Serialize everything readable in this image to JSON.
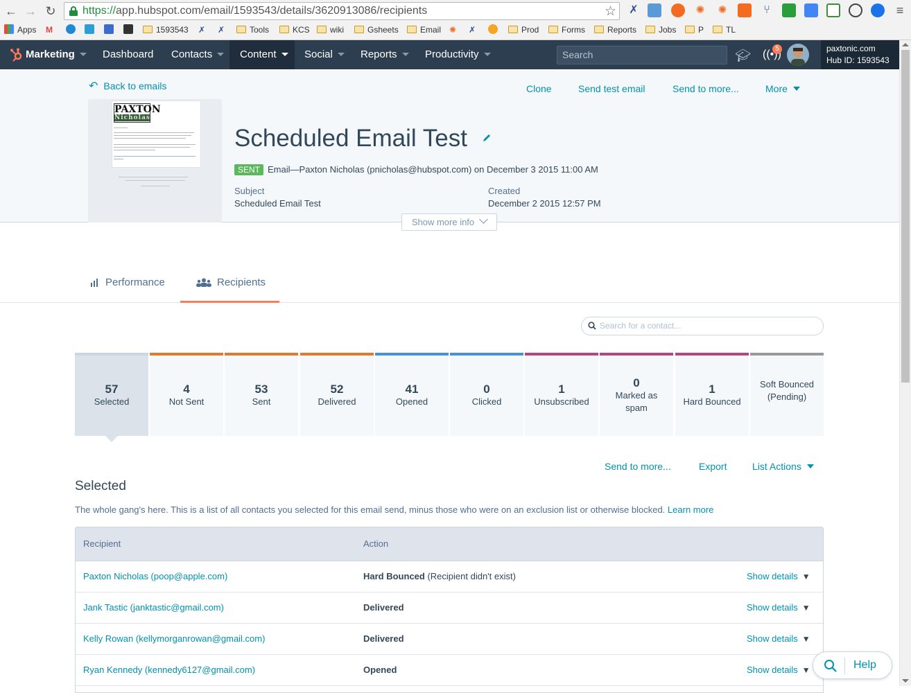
{
  "browser": {
    "url_scheme": "https://",
    "url_rest": "app.hubspot.com/email/1593543/details/3620913086/recipients",
    "bookmarks": [
      "Apps",
      "1593543",
      "Tools",
      "KCS",
      "wiki",
      "Gsheets",
      "Email",
      "Prod",
      "Forms",
      "Reports",
      "Jobs",
      "P",
      "TL"
    ]
  },
  "topnav": {
    "brand": "Marketing",
    "items": [
      "Dashboard",
      "Contacts",
      "Content",
      "Social",
      "Reports",
      "Productivity"
    ],
    "search_placeholder": "Search",
    "notification_count": "5",
    "portal_name": "paxtonic.com",
    "hub_id": "Hub ID: 1593543"
  },
  "header": {
    "back_label": "Back to emails",
    "actions": [
      "Clone",
      "Send test email",
      "Send to more...",
      "More"
    ],
    "title": "Scheduled Email Test",
    "sent_badge": "SENT",
    "sent_info": "Email—Paxton Nicholas (pnicholas@hubspot.com) on December 3 2015 11:00 AM",
    "subject_label": "Subject",
    "subject_value": "Scheduled Email Test",
    "created_label": "Created",
    "created_value": "December 2 2015 12:57 PM",
    "show_more": "Show more info",
    "thumb_logo": "PAXTON",
    "thumb_logo_sub": "Nicholas"
  },
  "tabs": {
    "performance": "Performance",
    "recipients": "Recipients"
  },
  "search_placeholder": "Search for a contact...",
  "stats": [
    {
      "num": "57",
      "label": "Selected",
      "color": "#cbd6e2"
    },
    {
      "num": "4",
      "label": "Not Sent",
      "color": "#e07a2e"
    },
    {
      "num": "53",
      "label": "Sent",
      "color": "#e07a2e"
    },
    {
      "num": "52",
      "label": "Delivered",
      "color": "#e07a2e"
    },
    {
      "num": "41",
      "label": "Opened",
      "color": "#4a90d9"
    },
    {
      "num": "0",
      "label": "Clicked",
      "color": "#4a90d9"
    },
    {
      "num": "1",
      "label": "Unsubscribed",
      "color": "#b5467d"
    },
    {
      "num": "0",
      "label": "Marked as spam",
      "color": "#b5467d"
    },
    {
      "num": "1",
      "label": "Hard Bounced",
      "color": "#b5467d"
    },
    {
      "num": "",
      "label": "Soft Bounced (Pending)",
      "color": "#999999"
    }
  ],
  "list_actions": {
    "send_more": "Send to more...",
    "export": "Export",
    "list_actions": "List Actions"
  },
  "selected": {
    "title": "Selected",
    "description": "The whole gang's here. This is a list of all contacts you selected for this email send, minus those who were on an exclusion list or otherwise blocked.",
    "learn_more": "Learn more"
  },
  "table": {
    "col_recipient": "Recipient",
    "col_action": "Action",
    "show_details": "Show details",
    "rows": [
      {
        "recipient": "Paxton Nicholas (poop@apple.com)",
        "action": "Hard Bounced",
        "note": " (Recipient didn't exist)"
      },
      {
        "recipient": "Jank Tastic (janktastic@gmail.com)",
        "action": "Delivered",
        "note": ""
      },
      {
        "recipient": "Kelly Rowan (kellymorganrowan@gmail.com)",
        "action": "Delivered",
        "note": ""
      },
      {
        "recipient": "Ryan Kennedy (kennedy6127@gmail.com)",
        "action": "Opened",
        "note": ""
      }
    ]
  },
  "help_label": "Help"
}
